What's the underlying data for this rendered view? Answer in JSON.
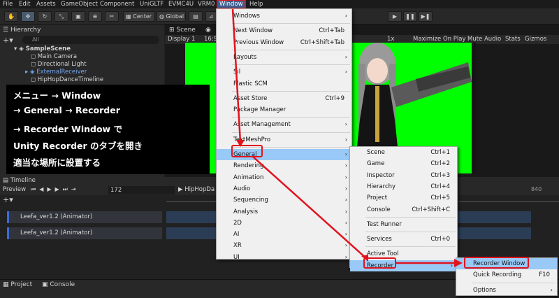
{
  "menubar": [
    "File",
    "Edit",
    "Assets",
    "GameObject",
    "Component",
    "UniGLTF",
    "EVMC4U",
    "VRM0",
    "Window",
    "Help"
  ],
  "toolbar": {
    "center": "Center",
    "global": "Global"
  },
  "hierarchy": {
    "title": "Hierarchy",
    "search_placeholder": "All",
    "items": [
      "SampleScene",
      "Main Camera",
      "Directional Light",
      "ExternalReceiver",
      "HipHopDanceTimeline"
    ]
  },
  "scene_tab": "Scene",
  "game": {
    "display": "Display 1",
    "aspect": "16:9",
    "scale": "1x",
    "buttons": [
      "Maximize On Play",
      "Mute Audio",
      "Stats",
      "Gizmos"
    ]
  },
  "overlay_lines": [
    "メニュー → Window",
    "→ General → Recorder",
    "→ Recorder Window で",
    "Unity Recorder のタブを開き",
    "適当な場所に設置する"
  ],
  "timeline": {
    "title": "Timeline",
    "preview": "Preview",
    "frame": "172",
    "asset": "HipHopDa",
    "ruler_right": "840",
    "tracks": [
      "Leefa_ver1.2 (Animator)",
      "Leefa_ver1.2 (Animator)"
    ]
  },
  "bottom_tabs": [
    "Project",
    "Console"
  ],
  "window_menu": [
    {
      "label": "Windows",
      "arrow": true
    },
    {
      "sep": true
    },
    {
      "label": "Next Window",
      "shortcut": "Ctrl+Tab"
    },
    {
      "label": "Previous Window",
      "shortcut": "Ctrl+Shift+Tab"
    },
    {
      "sep": true
    },
    {
      "label": "Layouts",
      "arrow": true
    },
    {
      "sep": true
    },
    {
      "label": "Sil",
      "arrow": true
    },
    {
      "label": "Plastic SCM"
    },
    {
      "sep": true
    },
    {
      "label": "Asset Store",
      "shortcut": "Ctrl+9"
    },
    {
      "label": "Package Manager"
    },
    {
      "sep": true
    },
    {
      "label": "Asset Management",
      "arrow": true
    },
    {
      "sep": true
    },
    {
      "label": "TextMeshPro",
      "arrow": true
    },
    {
      "sep": true
    },
    {
      "label": "General",
      "arrow": true,
      "highlight": true
    },
    {
      "label": "Rendering",
      "arrow": true
    },
    {
      "label": "Animation",
      "arrow": true
    },
    {
      "label": "Audio",
      "arrow": true
    },
    {
      "label": "Sequencing",
      "arrow": true
    },
    {
      "label": "Analysis",
      "arrow": true
    },
    {
      "label": "2D",
      "arrow": true
    },
    {
      "label": "AI",
      "arrow": true
    },
    {
      "label": "XR",
      "arrow": true
    },
    {
      "label": "UI",
      "arrow": true
    }
  ],
  "general_menu": [
    {
      "label": "Scene",
      "shortcut": "Ctrl+1"
    },
    {
      "label": "Game",
      "shortcut": "Ctrl+2"
    },
    {
      "label": "Inspector",
      "shortcut": "Ctrl+3"
    },
    {
      "label": "Hierarchy",
      "shortcut": "Ctrl+4"
    },
    {
      "label": "Project",
      "shortcut": "Ctrl+5"
    },
    {
      "label": "Console",
      "shortcut": "Ctrl+Shift+C"
    },
    {
      "sep": true
    },
    {
      "label": "Test Runner"
    },
    {
      "sep": true
    },
    {
      "label": "Services",
      "shortcut": "Ctrl+0"
    },
    {
      "sep": true
    },
    {
      "label": "Active Tool"
    },
    {
      "label": "Recorder",
      "arrow": true,
      "highlight": true
    }
  ],
  "recorder_menu": [
    {
      "label": "Recorder Window",
      "highlight": true
    },
    {
      "label": "Quick Recording",
      "shortcut": "F10"
    },
    {
      "sep": true
    },
    {
      "label": "Options",
      "arrow": true
    }
  ],
  "colors": {
    "annotation_red": "#e0141e",
    "menu_highlight": "#99c9f6",
    "green_screen": "#00ff00"
  }
}
